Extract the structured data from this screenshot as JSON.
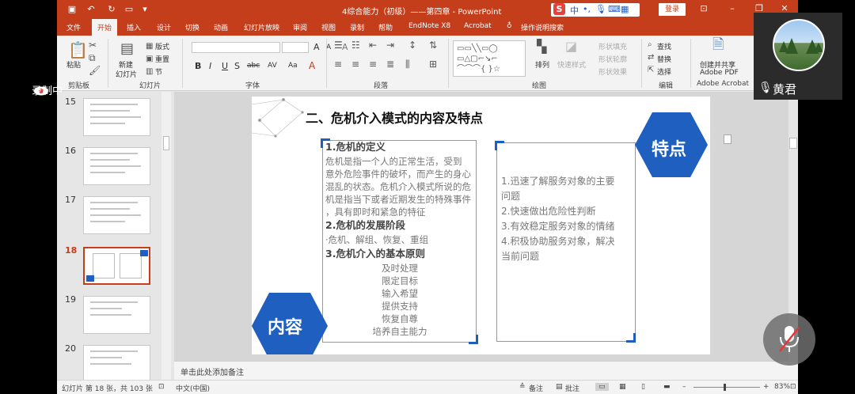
{
  "titlebar": {
    "doc_title": "4综合能力（初级）——第四章  -  PowerPoint",
    "ime": {
      "brand": "S",
      "mode": "中",
      "punct": "•,"
    },
    "login": "登录"
  },
  "tabs": [
    "文件",
    "开始",
    "插入",
    "设计",
    "切换",
    "动画",
    "幻灯片放映",
    "审阅",
    "视图",
    "录制",
    "帮助",
    "EndNote X8",
    "Acrobat"
  ],
  "tell_me": "操作说明搜索",
  "ribbon": {
    "clipboard": {
      "paste": "粘贴",
      "label": "剪贴板"
    },
    "slides": {
      "new_slide_1": "新建",
      "new_slide_2": "幻灯片",
      "layout": "版式",
      "reset": "重置",
      "section": "节",
      "label": "幻灯片"
    },
    "font": {
      "label": "字体",
      "bold": "B",
      "italic": "I",
      "underline": "U",
      "shadow": "S",
      "strike": "abc",
      "spacing": "AV",
      "case": "Aa",
      "grow": "A",
      "shrink": "A",
      "clear": "A"
    },
    "paragraph": {
      "label": "段落"
    },
    "drawing": {
      "arrange": "排列",
      "quick_styles": "快速样式",
      "fill": "形状填充",
      "outline": "形状轮廓",
      "effects": "形状效果",
      "label": "绘图"
    },
    "editing": {
      "find": "查找",
      "replace": "替换",
      "select": "选择",
      "label": "编辑"
    },
    "acrobat": {
      "line1": "创建并共享",
      "line2": "Adobe PDF",
      "label": "Adobe Acrobat"
    }
  },
  "thumbnails": [
    {
      "num": "15",
      "active": false
    },
    {
      "num": "16",
      "active": false
    },
    {
      "num": "17",
      "active": false
    },
    {
      "num": "18",
      "active": true
    },
    {
      "num": "19",
      "active": false
    },
    {
      "num": "20",
      "active": false
    }
  ],
  "slide": {
    "title": "二、危机介入模式的内容及特点",
    "content_badge": "内容",
    "feature_badge": "特点",
    "content": [
      {
        "text": "1.危机的定义",
        "style": "head"
      },
      {
        "text": "    危机是指一个人的正常生活，受到",
        "style": "body"
      },
      {
        "text": "意外危险事件的破坏，而产生的身心",
        "style": "body"
      },
      {
        "text": "混乱的状态。危机介入模式所说的危",
        "style": "body"
      },
      {
        "text": "机是指当下或者近期发生的特殊事件",
        "style": "body"
      },
      {
        "text": "，具有即时和紧急的特征",
        "style": "body"
      },
      {
        "text": "2.危机的发展阶段",
        "style": "head"
      },
      {
        "text": "·危机、解组、恢复、重组",
        "style": "body"
      },
      {
        "text": "3.危机介入的基本原则",
        "style": "head"
      },
      {
        "text": "及时处理",
        "style": "center"
      },
      {
        "text": "限定目标",
        "style": "center"
      },
      {
        "text": "输入希望",
        "style": "center"
      },
      {
        "text": "提供支持",
        "style": "center"
      },
      {
        "text": "恢复自尊",
        "style": "center"
      },
      {
        "text": "培养自主能力",
        "style": "center"
      }
    ],
    "features": [
      "1.迅速了解服务对象的主要",
      "问题",
      "2.快速做出危险性判断",
      "3.有效稳定服务对象的情绪",
      "4.积极协助服务对象，解决",
      "当前问题"
    ]
  },
  "notes_placeholder": "单击此处添加备注",
  "status": {
    "slide_info": "幻灯片 第 18 张，共 103 张",
    "language": "中文(中国)",
    "notes": "备注",
    "comments": "批注",
    "zoom": "83%"
  },
  "meeting": {
    "user_name": "黄君",
    "recording": "录制中"
  },
  "colors": {
    "accent": "#c43e1c",
    "hex_blue": "#1f5fbf",
    "bracket_blue": "#1d5fbe"
  }
}
